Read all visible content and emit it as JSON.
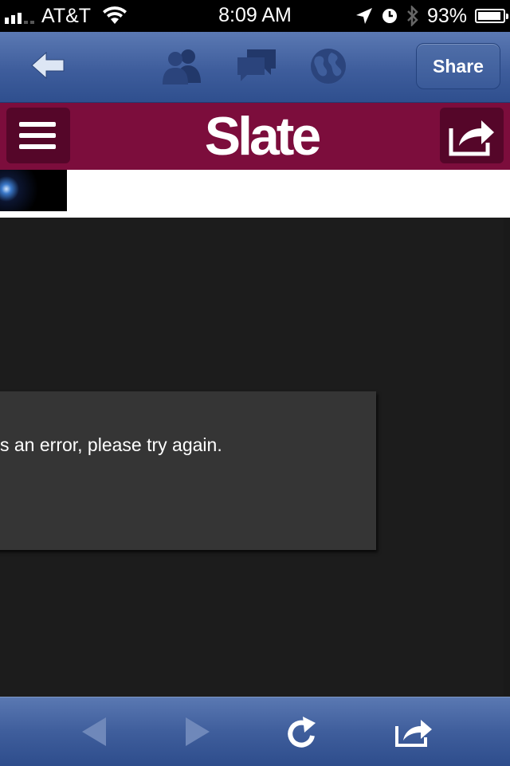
{
  "status_bar": {
    "carrier": "AT&T",
    "time": "8:09 AM",
    "battery": "93%",
    "battery_level": 0.93,
    "signal_bars": 3
  },
  "nav_bar": {
    "share_label": "Share",
    "icons": [
      "back-arrow-icon",
      "friends-icon",
      "messages-icon",
      "globe-icon"
    ]
  },
  "slate_header": {
    "logo": "Slate",
    "background_color": "#7c0d3c"
  },
  "dialog": {
    "message": "s an error, please try again."
  },
  "toolbar": {
    "icons": [
      "browser-back-icon",
      "browser-forward-icon",
      "reload-icon",
      "share-icon"
    ],
    "color": "#3f5e9c"
  }
}
